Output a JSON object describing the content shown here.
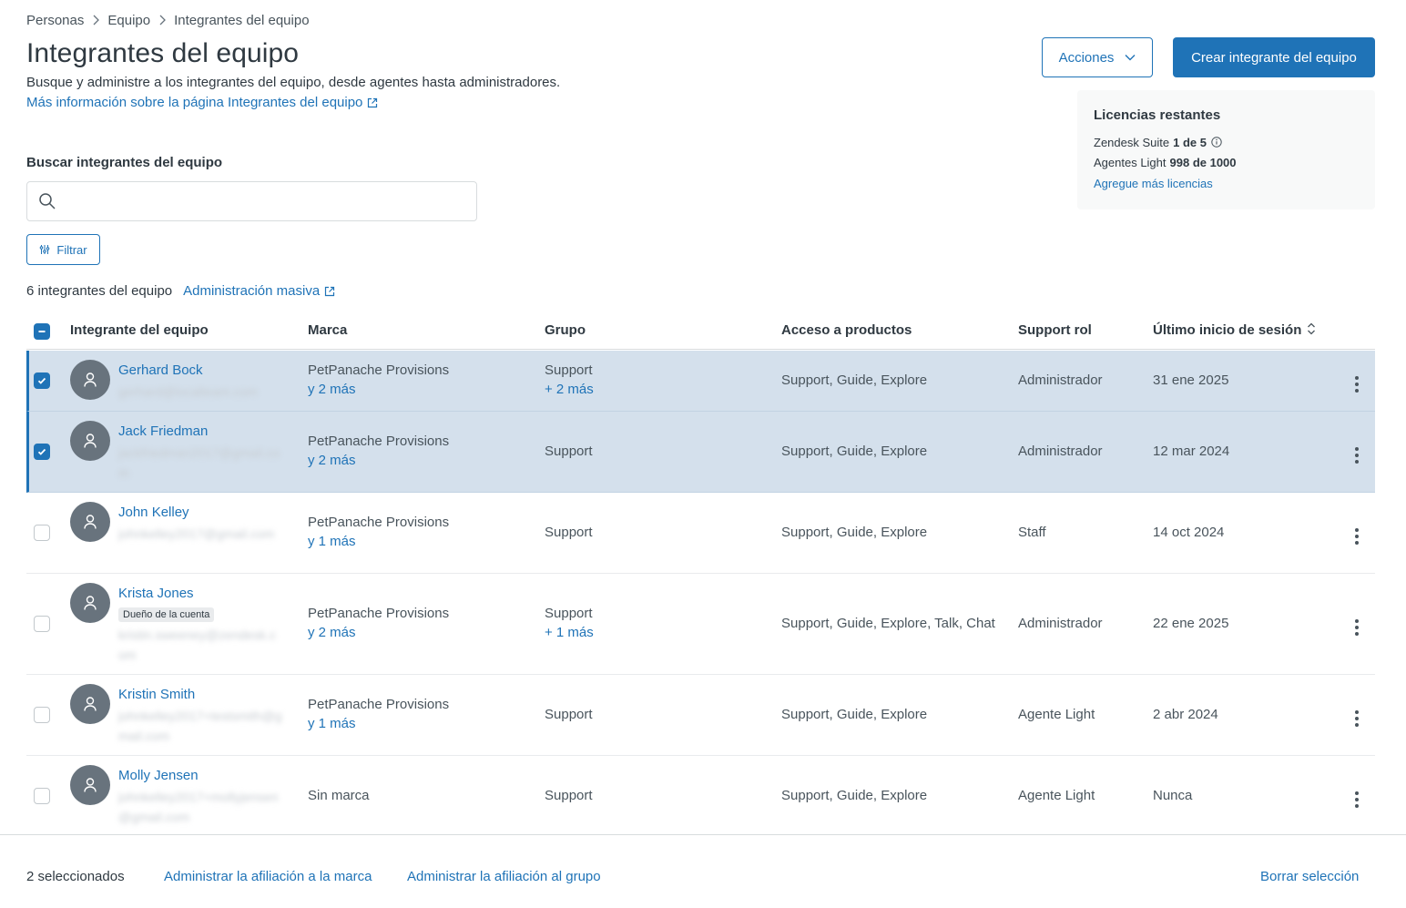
{
  "breadcrumb": [
    "Personas",
    "Equipo",
    "Integrantes del equipo"
  ],
  "title": "Integrantes del equipo",
  "description": "Busque y administre a los integrantes del equipo, desde agentes hasta administradores.",
  "learn_more": "Más información sobre la página Integrantes del equipo",
  "actions_button": "Acciones",
  "create_button": "Crear integrante del equipo",
  "licenses": {
    "title": "Licencias restantes",
    "suite_label": "Zendesk Suite",
    "suite_value": "1 de 5",
    "light_label": "Agentes Light",
    "light_value": "998 de 1000",
    "add_link": "Agregue más licencias"
  },
  "search": {
    "label": "Buscar integrantes del equipo",
    "value": "",
    "placeholder": ""
  },
  "filter_button": "Filtrar",
  "member_count": "6 integrantes del equipo",
  "bulk_link": "Administración masiva",
  "columns": [
    "Integrante del equipo",
    "Marca",
    "Grupo",
    "Acceso a productos",
    "Support rol",
    "Último inicio de sesión"
  ],
  "rows": [
    {
      "name": "Gerhard Bock",
      "email": "gerhard@localteam.com",
      "brand": "PetPanache Provisions",
      "brand_more": "y 2 más",
      "group": "Support",
      "group_more": "+ 2 más",
      "access": "Support, Guide, Explore",
      "role": "Administrador",
      "last_login": "31 ene 2025",
      "selected": true
    },
    {
      "name": "Jack Friedman",
      "email": "jackfriedman2017@gmail.com",
      "brand": "PetPanache Provisions",
      "brand_more": "y 2 más",
      "group": "Support",
      "group_more": "",
      "access": "Support, Guide, Explore",
      "role": "Administrador",
      "last_login": "12 mar 2024",
      "selected": true
    },
    {
      "name": "John Kelley",
      "email": "johnkelley2017@gmail.com",
      "brand": "PetPanache Provisions",
      "brand_more": "y 1 más",
      "group": "Support",
      "group_more": "",
      "access": "Support, Guide, Explore",
      "role": "Staff",
      "last_login": "14 oct 2024",
      "selected": false
    },
    {
      "name": "Krista Jones",
      "badge": "Dueño de la cuenta",
      "email": "kristin.sweeney@zendesk.com",
      "brand": "PetPanache Provisions",
      "brand_more": "y 2 más",
      "group": "Support",
      "group_more": "+ 1 más",
      "access": "Support, Guide, Explore, Talk, Chat",
      "role": "Administrador",
      "last_login": "22 ene 2025",
      "selected": false
    },
    {
      "name": "Kristin Smith",
      "email": "johnkelley2017+testsmith@gmail.com",
      "brand": "PetPanache Provisions",
      "brand_more": "y 1 más",
      "group": "Support",
      "group_more": "",
      "access": "Support, Guide, Explore",
      "role": "Agente Light",
      "last_login": "2 abr 2024",
      "selected": false
    },
    {
      "name": "Molly Jensen",
      "email": "johnkelley2017+mollyjensen@gmail.com",
      "brand": "Sin marca",
      "brand_more": "",
      "group": "Support",
      "group_more": "",
      "access": "Support, Guide, Explore",
      "role": "Agente Light",
      "last_login": "Nunca",
      "selected": false
    }
  ],
  "footer": {
    "selected_count": "2 seleccionados",
    "brand_link": "Administrar la afiliación a la marca",
    "group_link": "Administrar la afiliación al grupo",
    "clear_link": "Borrar selección"
  },
  "colors": {
    "accent": "#1f73b7",
    "selected_row": "#d4e0ec",
    "avatar": "#68737d"
  }
}
